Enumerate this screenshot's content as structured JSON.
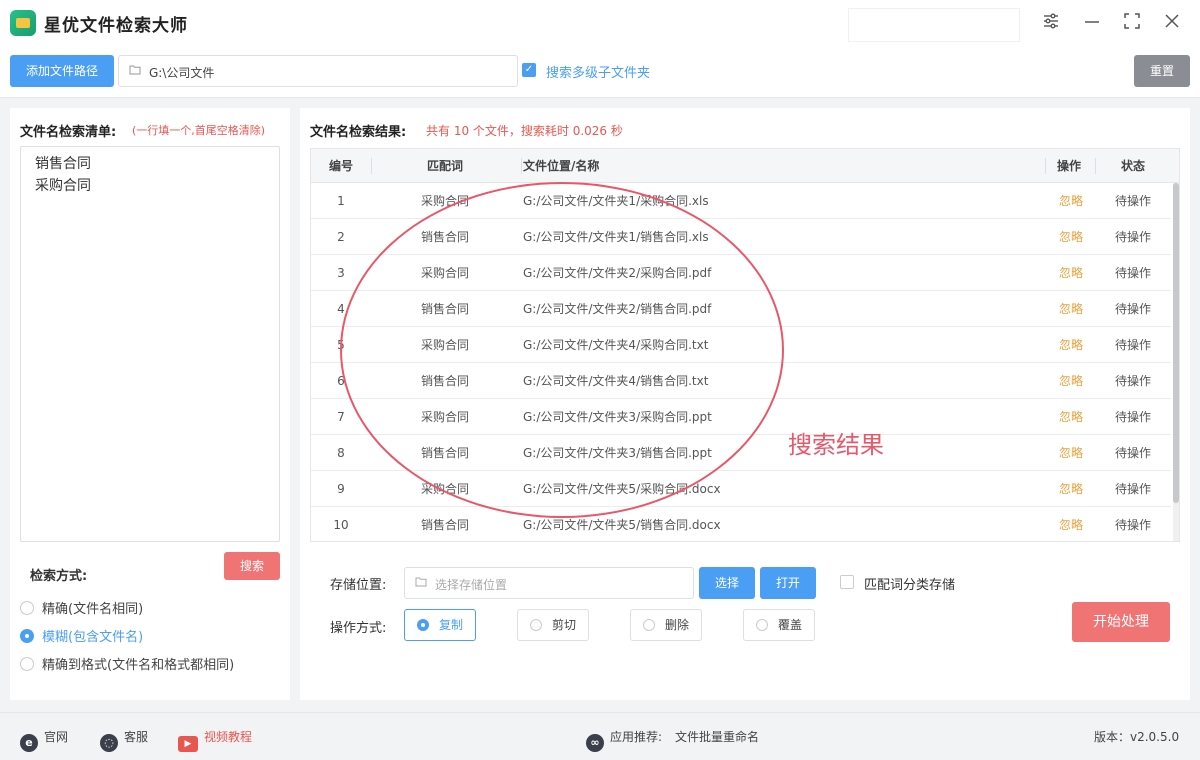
{
  "app": {
    "title": "星优文件检索大师"
  },
  "window": {
    "settings_icon": "sliders-icon",
    "minimize": "—",
    "maximize": "⛶",
    "close": "✕"
  },
  "toolbar": {
    "add_path_label": "添加文件路径",
    "path_value": "G:\\公司文件",
    "subfolder_label": "搜索多级子文件夹",
    "subfolder_checked": true,
    "reset_label": "重置"
  },
  "left": {
    "title": "文件名检索清单:",
    "hint": "(一行填一个,首尾空格清除)",
    "keywords": [
      "销售合同",
      "采购合同"
    ],
    "search_label": "搜索",
    "mode_title": "检索方式:",
    "modes": [
      {
        "label": "精确(文件名相同)",
        "selected": false
      },
      {
        "label": "模糊(包含文件名)",
        "selected": true
      },
      {
        "label": "精确到格式(文件名和格式都相同)",
        "selected": false
      }
    ]
  },
  "results": {
    "title": "文件名检索结果:",
    "summary": "共有 10 个文件，搜索耗时 0.026 秒",
    "columns": {
      "num": "编号",
      "keyword": "匹配词",
      "path": "文件位置/名称",
      "op": "操作",
      "status": "状态"
    },
    "rows": [
      {
        "num": "1",
        "keyword": "采购合同",
        "path": "G:/公司文件/文件夹1/采购合同.xls",
        "op": "忽略",
        "status": "待操作"
      },
      {
        "num": "2",
        "keyword": "销售合同",
        "path": "G:/公司文件/文件夹1/销售合同.xls",
        "op": "忽略",
        "status": "待操作"
      },
      {
        "num": "3",
        "keyword": "采购合同",
        "path": "G:/公司文件/文件夹2/采购合同.pdf",
        "op": "忽略",
        "status": "待操作"
      },
      {
        "num": "4",
        "keyword": "销售合同",
        "path": "G:/公司文件/文件夹2/销售合同.pdf",
        "op": "忽略",
        "status": "待操作"
      },
      {
        "num": "5",
        "keyword": "采购合同",
        "path": "G:/公司文件/文件夹4/采购合同.txt",
        "op": "忽略",
        "status": "待操作"
      },
      {
        "num": "6",
        "keyword": "销售合同",
        "path": "G:/公司文件/文件夹4/销售合同.txt",
        "op": "忽略",
        "status": "待操作"
      },
      {
        "num": "7",
        "keyword": "采购合同",
        "path": "G:/公司文件/文件夹3/采购合同.ppt",
        "op": "忽略",
        "status": "待操作"
      },
      {
        "num": "8",
        "keyword": "销售合同",
        "path": "G:/公司文件/文件夹3/销售合同.ppt",
        "op": "忽略",
        "status": "待操作"
      },
      {
        "num": "9",
        "keyword": "采购合同",
        "path": "G:/公司文件/文件夹5/采购合同.docx",
        "op": "忽略",
        "status": "待操作"
      },
      {
        "num": "10",
        "keyword": "销售合同",
        "path": "G:/公司文件/文件夹5/销售合同.docx",
        "op": "忽略",
        "status": "待操作"
      }
    ],
    "annotation": "搜索结果",
    "annotation_color": "#e8586a"
  },
  "output": {
    "save_label": "存储位置:",
    "save_placeholder": "选择存储位置",
    "choose_label": "选择",
    "open_label": "打开",
    "classify_label": "匹配词分类存储",
    "op_mode_label": "操作方式:",
    "ops": [
      {
        "label": "复制",
        "selected": true
      },
      {
        "label": "剪切",
        "selected": false
      },
      {
        "label": "删除",
        "selected": false
      },
      {
        "label": "覆盖",
        "selected": false
      }
    ],
    "start_label": "开始处理"
  },
  "footer": {
    "website": "官网",
    "service": "客服",
    "video": "视频教程",
    "recommend_prefix": "应用推荐:",
    "recommend_app": "文件批量重命名",
    "version": "版本：v2.0.5.0"
  },
  "colors": {
    "accent": "#4a9ff5",
    "danger": "#f07474",
    "warning": "#e6a23c"
  }
}
